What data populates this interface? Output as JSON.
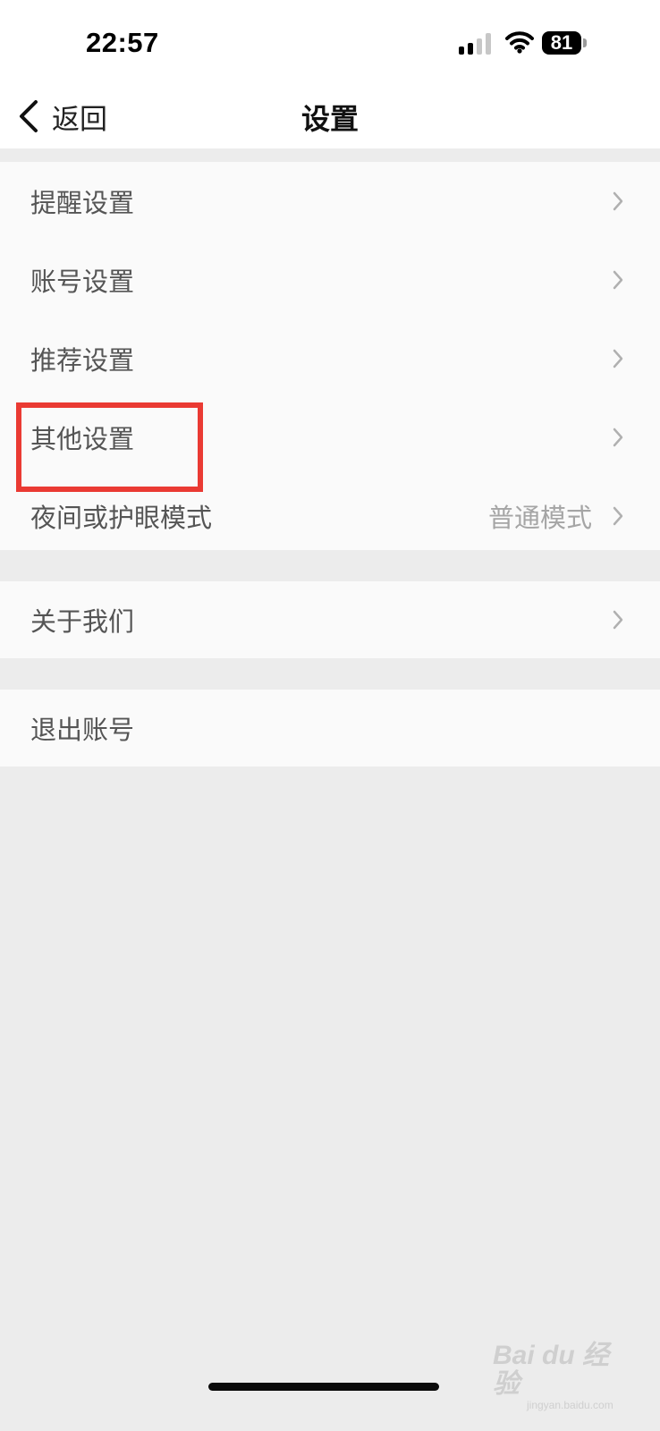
{
  "status_bar": {
    "time": "22:57",
    "battery": "81"
  },
  "nav": {
    "back_label": "返回",
    "title": "设置"
  },
  "settings_groups": [
    {
      "items": [
        {
          "label": "提醒设置"
        },
        {
          "label": "账号设置"
        },
        {
          "label": "推荐设置"
        },
        {
          "label": "其他设置"
        },
        {
          "label": "夜间或护眼模式",
          "value": "普通模式"
        }
      ]
    },
    {
      "items": [
        {
          "label": "关于我们"
        }
      ]
    },
    {
      "items": [
        {
          "label": "退出账号"
        }
      ]
    }
  ],
  "watermark": {
    "main": "Bai du 经验",
    "sub": "jingyan.baidu.com"
  },
  "colors": {
    "page_background": "#ececec",
    "row_background": "#fafafa",
    "highlight_box": "#ea3a33",
    "secondary_text": "#a5a5a5",
    "chevron": "#b0b0b0"
  },
  "icons": {
    "back": "chevron-left-icon",
    "row_arrow": "chevron-right-icon",
    "signal": "cellular-signal-icon",
    "wifi": "wifi-icon",
    "battery": "battery-icon"
  }
}
